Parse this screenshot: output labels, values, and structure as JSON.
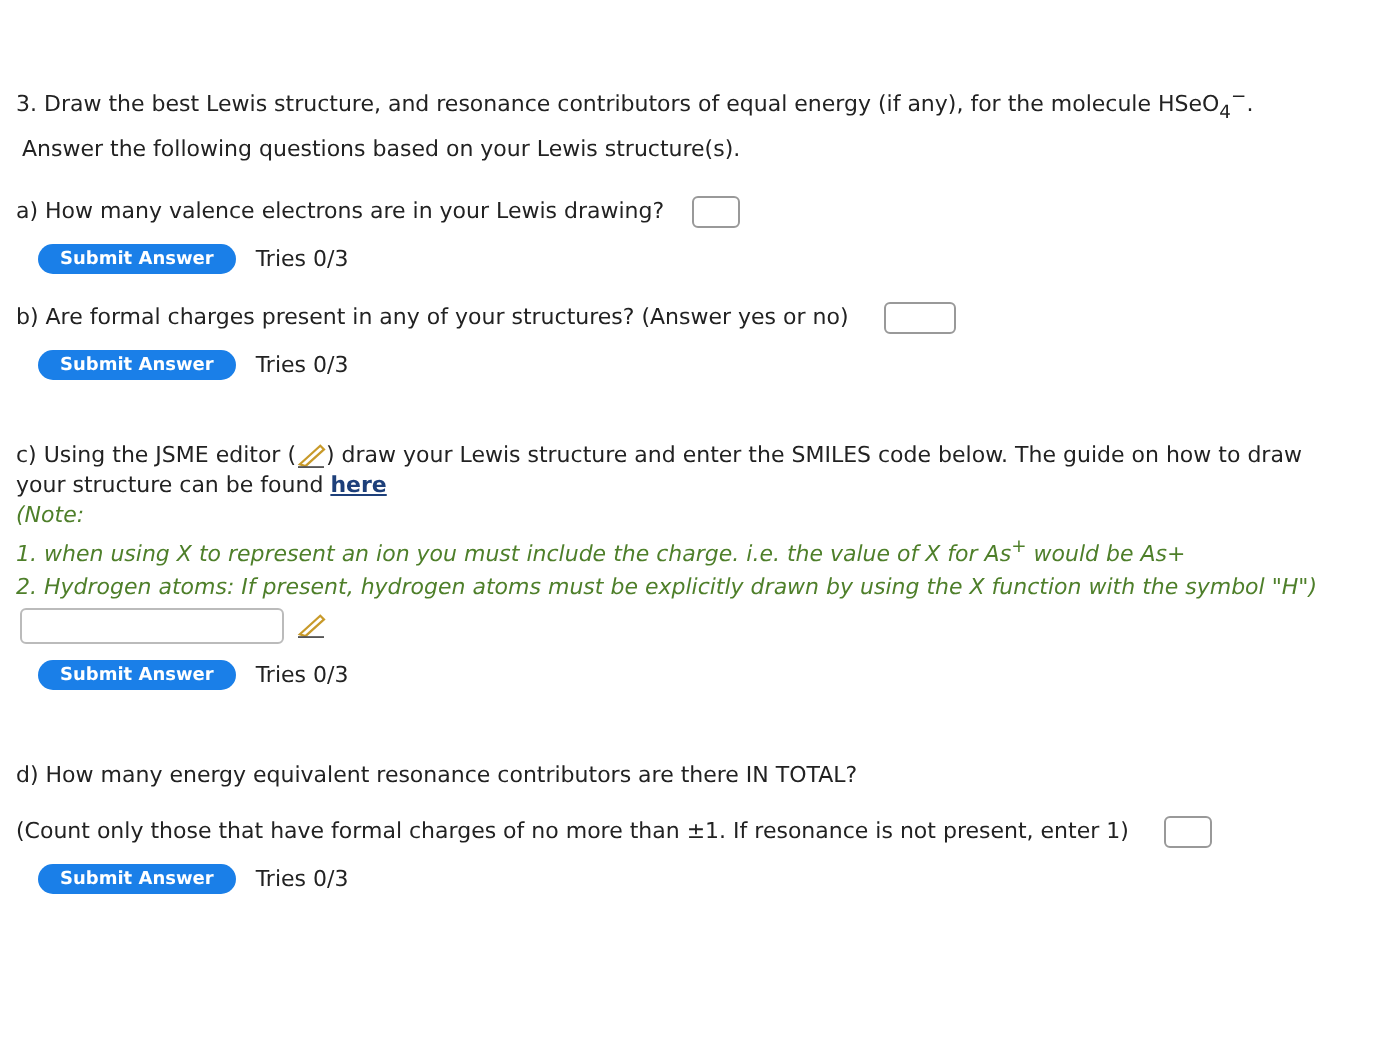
{
  "question": {
    "text": "3. Draw the best Lewis structure, and resonance contributors of equal energy (if any), for the molecule HSeO$_{4}$$^{−}$.",
    "subtext": "Answer the following questions based on your Lewis structure(s)."
  },
  "parts": [
    {
      "kind": "short",
      "prompt": "a) How many valence electrons are in your Lewis drawing?",
      "button": "Submit Answer",
      "tries": "Tries 0/3"
    },
    {
      "kind": "short",
      "prompt": "b) Are formal charges present in any of your structures? (Answer yes or no)",
      "button": "Submit Answer",
      "tries": "Tries 0/3"
    },
    {
      "kind": "smiles",
      "prompt_before": "c) Using the JSME editor (",
      "prompt_after": ") draw your Lewis structure and enter the SMILES code below. The guide on how to draw",
      "prompt_line2": "your structure can be found ",
      "link": "here",
      "note_title": "(Note:",
      "notes": [
        "1. when using X to represent an ion you must include the charge. i.e. the value of X for As$^{+}$ would be As+",
        "2. Hydrogen atoms: If present, hydrogen atoms must be explicitly drawn by using the X function with the symbol \"H\")"
      ],
      "button": "Submit Answer",
      "tries": "Tries 0/3"
    },
    {
      "kind": "long",
      "prompt": "d) How many energy equivalent resonance contributors are there IN TOTAL?",
      "sub_prompt": "(Count only those that have formal charges of no more than ±1. If resonance is not present, enter 1)",
      "button": "Submit Answer",
      "tries": "Tries 0/3"
    }
  ]
}
